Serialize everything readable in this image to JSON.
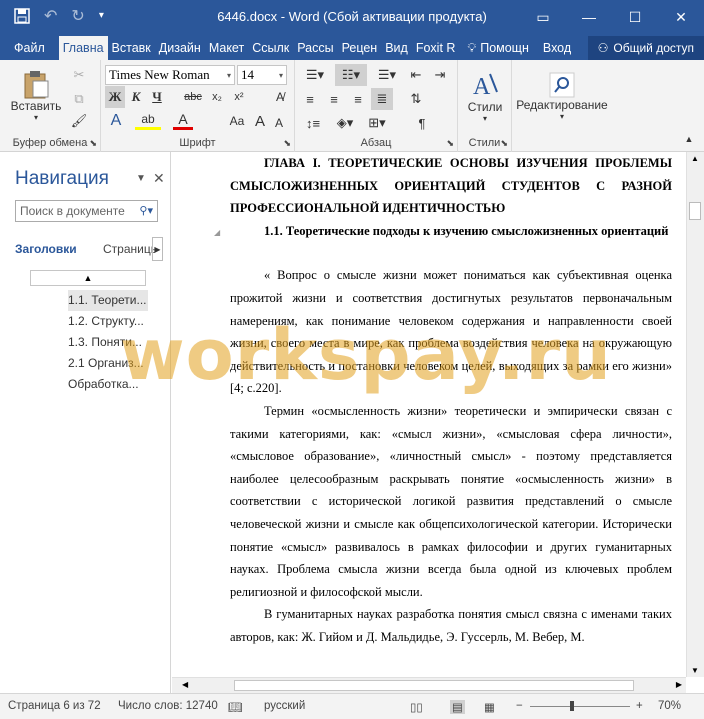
{
  "titlebar": {
    "title": "6446.docx - Word (Сбой активации продукта)",
    "icons": [
      "save-icon",
      "undo-icon",
      "redo-icon",
      "customize-qat-icon"
    ],
    "window_buttons": [
      "ribbon-display-icon",
      "minimize-icon",
      "maximize-icon",
      "close-icon"
    ]
  },
  "tabs": {
    "items": [
      "Файл",
      "Главна",
      "Вставк",
      "Дизайн",
      "Макет",
      "Ссылк",
      "Рассы",
      "Рецен",
      "Вид",
      "Foxit R"
    ],
    "active_index": 1,
    "help": "Помощн",
    "login": "Вход",
    "share": "Общий доступ"
  },
  "ribbon": {
    "clipboard": {
      "paste": "Вставить",
      "label": "Буфер обмена"
    },
    "font": {
      "name": "Times New Roman",
      "size": "14",
      "label": "Шрифт",
      "bold": "Ж",
      "italic": "К",
      "underline": "Ч",
      "strike": "abc",
      "subscript": "x₂",
      "superscript": "x²",
      "grow": "A",
      "shrink": "A",
      "case": "Aa",
      "font_color": "A",
      "highlight": "ab",
      "effects": "A"
    },
    "paragraph": {
      "label": "Абзац"
    },
    "styles": {
      "button": "Стили",
      "label": "Стили"
    },
    "editing": {
      "button": "Редактирование"
    }
  },
  "navigation": {
    "title": "Навигация",
    "search_placeholder": "Поиск в документе",
    "tab_headings": "Заголовки",
    "tab_pages": "Страницы",
    "items": [
      "1.1. Теорети...",
      "1.2. Структу...",
      "1.3. Поняти...",
      "2.1 Организ...",
      "Обработка..."
    ],
    "selected_index": 0
  },
  "document": {
    "heading1": "ГЛАВА I. ТЕОРЕТИЧЕСКИЕ ОСНОВЫ ИЗУЧЕНИЯ ПРОБЛЕМЫ СМЫСЛОЖИЗНЕННЫХ ОРИЕНТАЦИЙ СТУДЕНТОВ С РАЗНОЙ ПРОФЕССИОНАЛЬНОЙ ИДЕНТИЧНОСТЬЮ",
    "heading2": "1.1. Теоретические подходы к изучению смысложизненных ориентаций",
    "paragraphs": [
      "« Вопрос о смысле жизни может пониматься как субъективная оценка прожитой жизни и соответствия достигнутых результатов первоначальным намерениям, как понимание человеком содержания и направленности своей жизни, своего места в мире, как проблема воздействия человека на окружающую действительность и постановки человеком целей, выходящих за рамки его жизни» [4; с.220].",
      "Термин «осмысленность жизни» теоретически и эмпирически связан с такими категориями, как: «смысл жизни», «смысловая сфера личности», «смысловое образование», «личностный смысл» - поэтому представляется наиболее целесообразным раскрывать понятие «осмысленность жизни» в соответствии с исторической логикой развития представлений о смысле человеческой жизни и смысле как общепсихологической категории. Исторически понятие «смысл» развивалось в рамках философии и других гуманитарных науках. Проблема смысла жизни всегда была одной из ключевых проблем религиозной и философской мысли.",
      "В гуманитарных науках разработка понятия смысл связна с именами таких авторов, как: Ж. Гийом и Д. Мальдидье, Э. Гуссерль, М. Вебер, М."
    ],
    "watermark": "workspay.ru"
  },
  "status": {
    "page": "Страница 6 из 72",
    "words": "Число слов: 12740",
    "language": "русский",
    "zoom": "70%"
  }
}
